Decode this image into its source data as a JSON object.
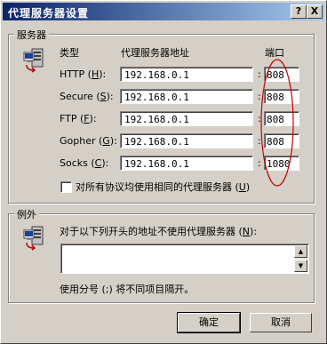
{
  "window": {
    "title": "代理服务器设置",
    "help_button": "?",
    "close_button": "X"
  },
  "servers": {
    "group_label": "服务器",
    "col_type": "类型",
    "col_address": "代理服务器地址",
    "col_port": "端口",
    "rows": [
      {
        "label_pre": "HTTP (",
        "mnemonic": "H",
        "label_post": "):",
        "address": "192.168.0.1",
        "port": "808"
      },
      {
        "label_pre": "Secure (",
        "mnemonic": "S",
        "label_post": "):",
        "address": "192.168.0.1",
        "port": "808"
      },
      {
        "label_pre": "FTP (",
        "mnemonic": "F",
        "label_post": "):",
        "address": "192.168.0.1",
        "port": "808"
      },
      {
        "label_pre": "Gopher (",
        "mnemonic": "G",
        "label_post": "):",
        "address": "192.168.0.1",
        "port": "808"
      },
      {
        "label_pre": "Socks (",
        "mnemonic": "C",
        "label_post": "):",
        "address": "192.168.0.1",
        "port": "1080"
      }
    ],
    "port_separator": ":",
    "same_proxy_checkbox": {
      "label_pre": "对所有协议均使用相同的代理服务器 (",
      "mnemonic": "U",
      "label_post": ")",
      "checked": false
    }
  },
  "exceptions": {
    "group_label": "例外",
    "description_pre": "对于以下列开头的地址不使用代理服务器 (",
    "mnemonic": "N",
    "description_post": "):",
    "value": "",
    "hint": "使用分号 (;) 将不同项目隔开。"
  },
  "buttons": {
    "ok": "确定",
    "cancel": "取消"
  },
  "colors": {
    "title_start": "#0a246a",
    "title_end": "#a6caf0",
    "annotation": "#cc0000",
    "face": "#d4d0c8"
  }
}
